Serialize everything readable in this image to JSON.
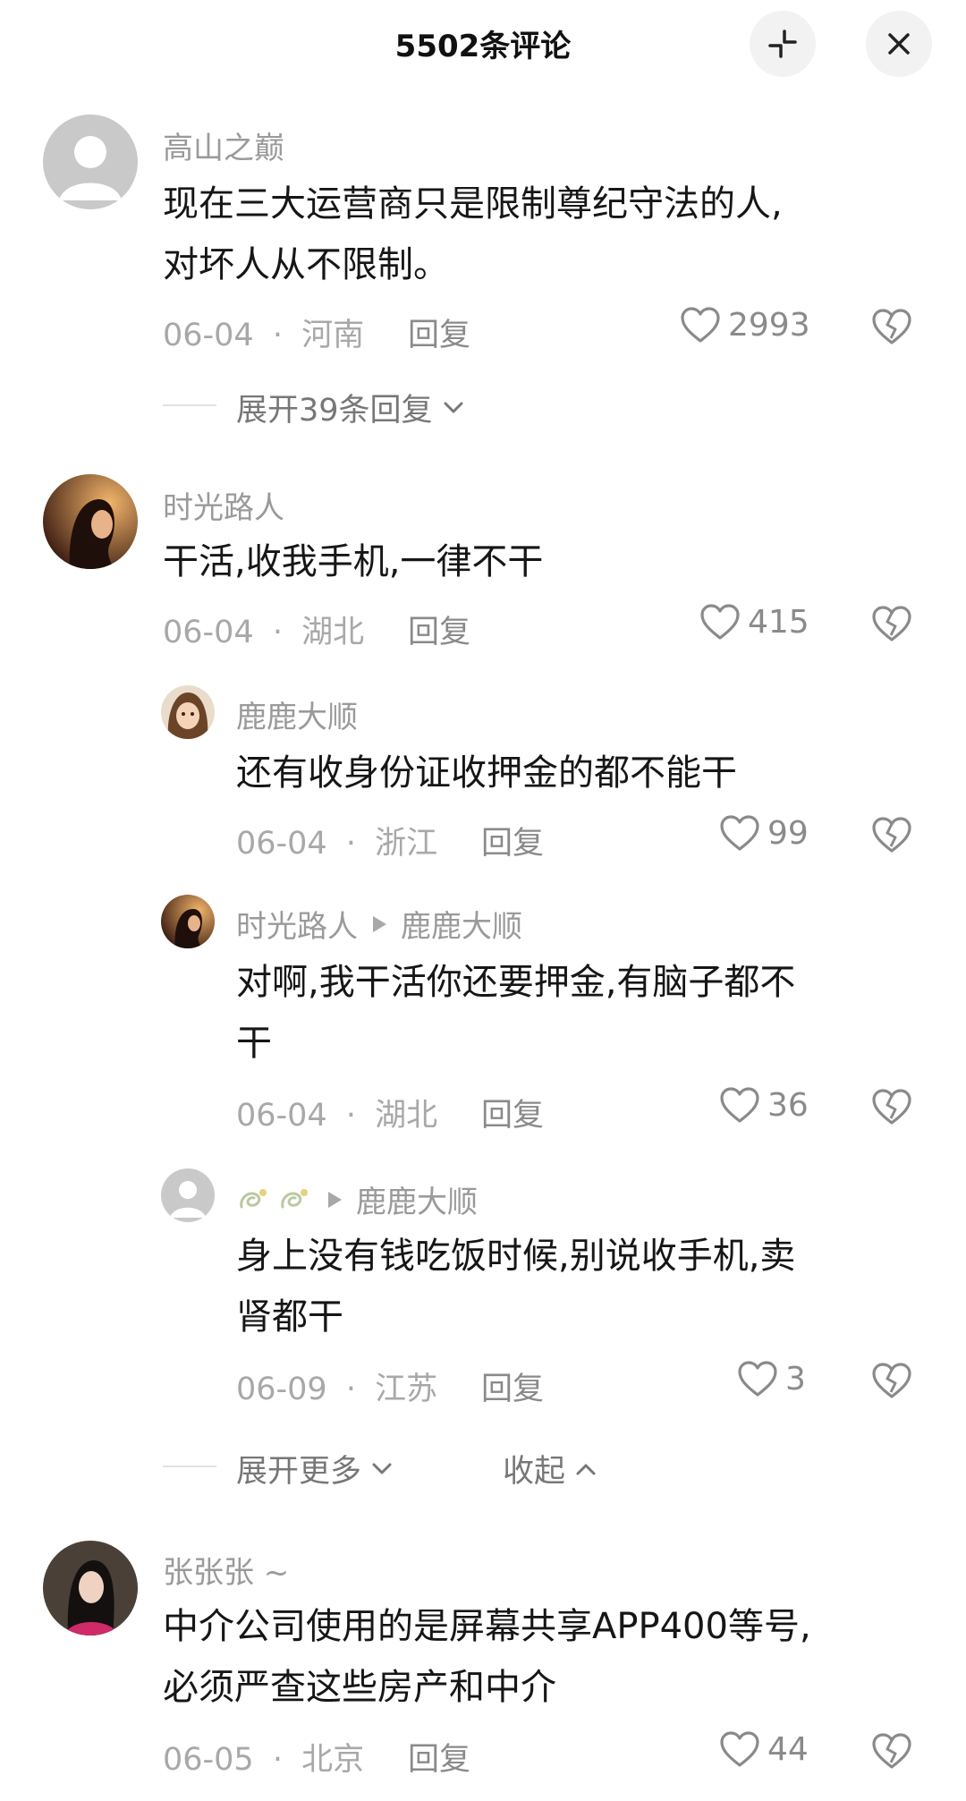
{
  "header": {
    "title": "5502条评论"
  },
  "comments": [
    {
      "username": "高山之巅",
      "text_line1": "现在三大运营商只是限制尊纪守法的人,",
      "text_line2": "对坏人从不限制。",
      "date": "06-04",
      "location": "河南",
      "reply_label": "回复",
      "likes": "2993",
      "expand_label": "展开39条回复"
    },
    {
      "username": "时光路人",
      "text": "干活,收我手机,一律不干",
      "date": "06-04",
      "location": "湖北",
      "reply_label": "回复",
      "likes": "415",
      "replies": [
        {
          "username": "鹿鹿大顺",
          "text": "还有收身份证收押金的都不能干",
          "date": "06-04",
          "location": "浙江",
          "reply_label": "回复",
          "likes": "99"
        },
        {
          "username": "时光路人",
          "reply_to": "鹿鹿大顺",
          "text_line1": "对啊,我干活你还要押金,有脑子都不",
          "text_line2": "干",
          "date": "06-04",
          "location": "湖北",
          "reply_label": "回复",
          "likes": "36"
        },
        {
          "username": "",
          "reply_to": "鹿鹿大顺",
          "text_line1": "身上没有钱吃饭时候,别说收手机,卖",
          "text_line2": "肾都干",
          "date": "06-09",
          "location": "江苏",
          "reply_label": "回复",
          "likes": "3"
        }
      ],
      "expand_more_label": "展开更多",
      "collapse_label": "收起"
    },
    {
      "username": "张张张 ~",
      "text_line1": "中介公司使用的是屏幕共享APP400等号,",
      "text_line2": "必须严查这些房产和中介",
      "date": "06-05",
      "location": "北京",
      "reply_label": "回复",
      "likes": "44"
    }
  ],
  "separator": "·",
  "icons": [
    "collapse-icon",
    "close-icon",
    "heart-icon",
    "broken-heart-icon",
    "chevron-down-icon",
    "chevron-up-icon",
    "play-triangle-icon",
    "dragon-emoji-icon"
  ]
}
